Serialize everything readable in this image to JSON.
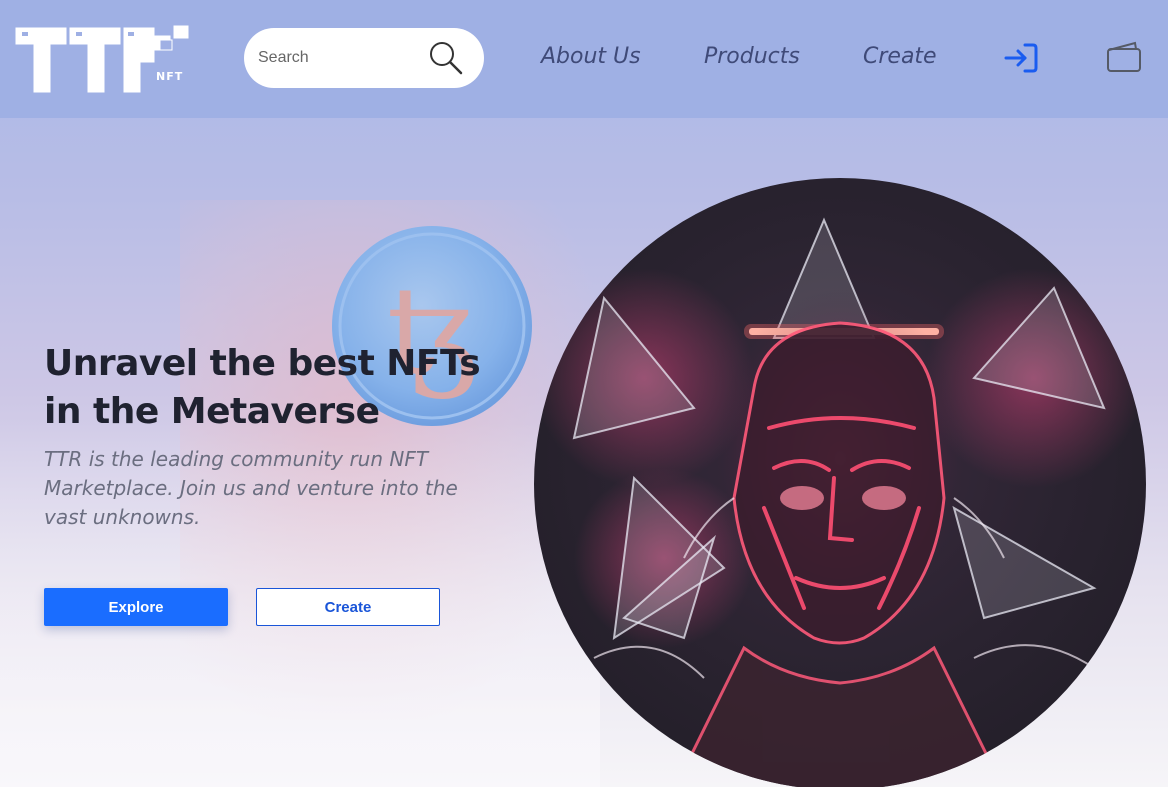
{
  "header": {
    "logo_text": "TTR",
    "logo_sub": "NFT",
    "search": {
      "placeholder": "Search"
    },
    "nav": [
      {
        "label": "About Us"
      },
      {
        "label": "Products"
      },
      {
        "label": "Create"
      }
    ],
    "icons": [
      "search-icon",
      "login-icon",
      "wallet-icon"
    ]
  },
  "hero": {
    "title": "Unravel the best NFTs in the Metaverse",
    "subtitle": "TTR is the leading community run NFT Marketplace. Join us and venture into the vast unknowns.",
    "explore_label": "Explore",
    "create_label": "Create",
    "coin_symbol": "ꜩ"
  },
  "colors": {
    "header_bg": "#9fb0e4",
    "accent": "#1a6dff",
    "nav_text": "#3f4a78",
    "title_text": "#1f2230"
  }
}
